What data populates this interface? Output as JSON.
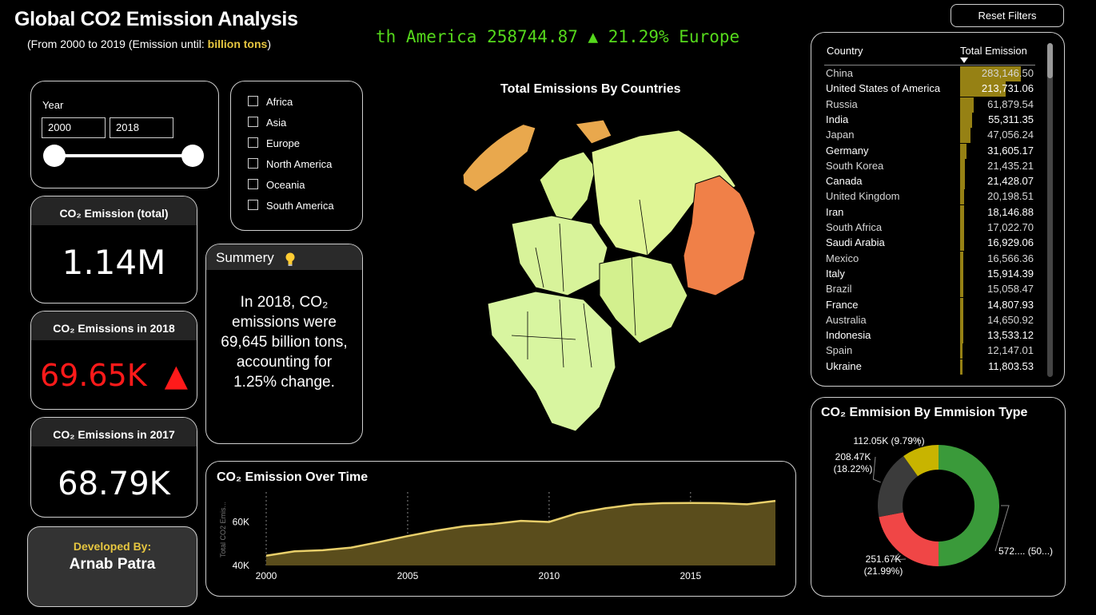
{
  "header": {
    "title": "Global CO2 Emission Analysis",
    "subtitle_prefix": "(From 2000 to 2019 (Emission until: ",
    "subtitle_highlight": "billion tons",
    "subtitle_suffix": ")",
    "ticker_text": "th America 258744.87 ▲ 21.29%     Europe"
  },
  "reset_button": {
    "label": "Reset Filters"
  },
  "year_filter": {
    "label": "Year",
    "from": "2000",
    "to": "2018"
  },
  "region_filter": {
    "items": [
      {
        "label": "Africa",
        "checked": false
      },
      {
        "label": "Asia",
        "checked": false
      },
      {
        "label": "Europe",
        "checked": false
      },
      {
        "label": "North America",
        "checked": false
      },
      {
        "label": "Oceania",
        "checked": false
      },
      {
        "label": "South America",
        "checked": false
      }
    ]
  },
  "kpis": {
    "total": {
      "label": "CO₂ Emission (total)",
      "value": "1.14M"
    },
    "y2018": {
      "label": "CO₂ Emissions in 2018",
      "value": "69.65K",
      "trend": "▲",
      "color": "#ff1a1a"
    },
    "y2017": {
      "label": "CO₂ Emissions in 2017",
      "value": "68.79K"
    }
  },
  "summary": {
    "title": "Summery",
    "icon": "lightbulb-icon",
    "text": "In 2018, CO₂ emissions were 69,645 billion tons, accounting for 1.25% change."
  },
  "map": {
    "title": "Total Emissions By Countries"
  },
  "country_table": {
    "col_country": "Country",
    "col_total": "Total Emission",
    "sort_icon": "sort-desc-icon",
    "rows": [
      {
        "country": "China",
        "value": "283,146.50",
        "n": 283146.5
      },
      {
        "country": "United States of America",
        "value": "213,731.06",
        "n": 213731.06
      },
      {
        "country": "Russia",
        "value": "61,879.54",
        "n": 61879.54
      },
      {
        "country": "India",
        "value": "55,311.35",
        "n": 55311.35
      },
      {
        "country": "Japan",
        "value": "47,056.24",
        "n": 47056.24
      },
      {
        "country": "Germany",
        "value": "31,605.17",
        "n": 31605.17
      },
      {
        "country": "South Korea",
        "value": "21,435.21",
        "n": 21435.21
      },
      {
        "country": "Canada",
        "value": "21,428.07",
        "n": 21428.07
      },
      {
        "country": "United Kingdom",
        "value": "20,198.51",
        "n": 20198.51
      },
      {
        "country": "Iran",
        "value": "18,146.88",
        "n": 18146.88
      },
      {
        "country": "South Africa",
        "value": "17,022.70",
        "n": 17022.7
      },
      {
        "country": "Saudi Arabia",
        "value": "16,929.06",
        "n": 16929.06
      },
      {
        "country": "Mexico",
        "value": "16,566.36",
        "n": 16566.36
      },
      {
        "country": "Italy",
        "value": "15,914.39",
        "n": 15914.39
      },
      {
        "country": "Brazil",
        "value": "15,058.47",
        "n": 15058.47
      },
      {
        "country": "France",
        "value": "14,807.93",
        "n": 14807.93
      },
      {
        "country": "Australia",
        "value": "14,650.92",
        "n": 14650.92
      },
      {
        "country": "Indonesia",
        "value": "13,533.12",
        "n": 13533.12
      },
      {
        "country": "Spain",
        "value": "12,147.01",
        "n": 12147.01
      },
      {
        "country": "Ukraine",
        "value": "11,803.53",
        "n": 11803.53
      }
    ]
  },
  "chart_data": [
    {
      "type": "area",
      "title": "CO₂ Emission Over Time",
      "xlabel": "",
      "ylabel": "Total CO2 Emis...",
      "x": [
        2000,
        2001,
        2002,
        2003,
        2004,
        2005,
        2006,
        2007,
        2008,
        2009,
        2010,
        2011,
        2012,
        2013,
        2014,
        2015,
        2016,
        2017,
        2018
      ],
      "values": [
        44500,
        46500,
        47000,
        48200,
        50800,
        53500,
        56000,
        58000,
        59000,
        60500,
        60000,
        64000,
        66300,
        68000,
        68600,
        68700,
        68600,
        68100,
        69650
      ],
      "x_ticks": [
        "2000",
        "2005",
        "2010",
        "2015"
      ],
      "y_ticks": [
        "40K",
        "60K"
      ],
      "ylim": [
        40000,
        73000
      ],
      "color": "#e8cf6a",
      "fill": "#5a4d1c"
    },
    {
      "type": "pie",
      "title": "CO₂ Emmision By Emmision Type",
      "slices": [
        {
          "label": "572.... (50...)",
          "value": 572,
          "color": "#3a9a3a"
        },
        {
          "label": "251.67K (21.99%)",
          "value": 251.67,
          "color": "#f04646"
        },
        {
          "label": "208.47K (18.22%)",
          "value": 208.47,
          "color": "#3b3b3b"
        },
        {
          "label": "112.05K (9.79%)",
          "value": 112.05,
          "color": "#c8b400"
        }
      ]
    }
  ],
  "footer": {
    "developed_by_label": "Developed By:",
    "developer_name": "Arnab Patra"
  }
}
